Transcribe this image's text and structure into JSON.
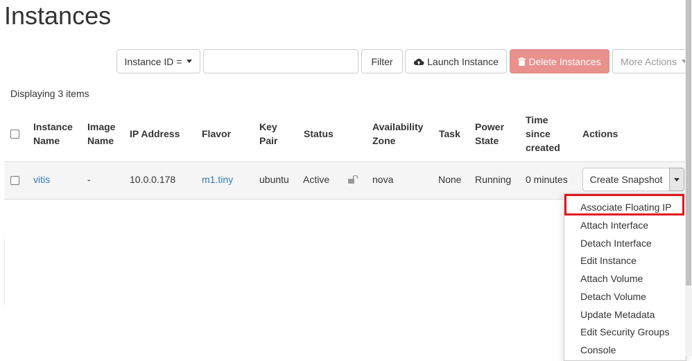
{
  "page": {
    "title": "Instances"
  },
  "toolbar": {
    "filter_field": "Instance ID =",
    "search_value": "",
    "filter_button": "Filter",
    "launch_button": "Launch Instance",
    "delete_button": "Delete Instances",
    "more_actions": "More Actions"
  },
  "table": {
    "count_text": "Displaying 3 items",
    "columns": {
      "instance_name": [
        "Instance",
        "Name"
      ],
      "image_name": [
        "Image",
        "Name"
      ],
      "ip_address": "IP Address",
      "flavor": "Flavor",
      "key_pair": [
        "Key",
        "Pair"
      ],
      "status": "Status",
      "availability_zone": [
        "Availability",
        "Zone"
      ],
      "task": "Task",
      "power_state": [
        "Power",
        "State"
      ],
      "time_since_created": [
        "Time",
        "since",
        "created"
      ],
      "actions": "Actions"
    },
    "rows": [
      {
        "name": "vitis",
        "image": "-",
        "ip": "10.0.0.178",
        "flavor": "m1.tiny",
        "key_pair": "ubuntu",
        "status": "Active",
        "zone": "nova",
        "task": "None",
        "power_state": "Running",
        "age": "0 minutes",
        "action": "Create Snapshot"
      }
    ]
  },
  "actions_menu": {
    "items": [
      "Associate Floating IP",
      "Attach Interface",
      "Detach Interface",
      "Edit Instance",
      "Attach Volume",
      "Detach Volume",
      "Update Metadata",
      "Edit Security Groups",
      "Console"
    ],
    "highlighted_index": 0,
    "highlight_color": "#e0191f"
  },
  "colors": {
    "link": "#337ab7",
    "danger_button": "#e8918d"
  }
}
